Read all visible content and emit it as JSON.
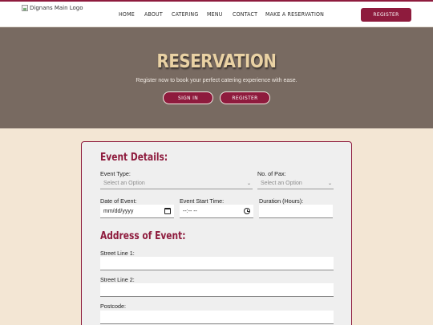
{
  "header": {
    "logo_alt": "Dignans Main Logo",
    "nav": [
      {
        "label": "HOME"
      },
      {
        "label": "ABOUT"
      },
      {
        "label": "CATERING"
      },
      {
        "label": "MENU"
      },
      {
        "label": "CONTACT"
      },
      {
        "label": "MAKE A RESERVATION"
      }
    ],
    "register_label": "REGISTER"
  },
  "hero": {
    "title": "RESERVATION",
    "subtitle": "Register now to book your perfect catering experience with ease.",
    "sign_in_label": "SIGN IN",
    "register_label": "REGISTER"
  },
  "form": {
    "event_details": {
      "title": "Event Details:",
      "event_type": {
        "label": "Event Type:",
        "value": "Select an Option"
      },
      "pax": {
        "label": "No. of Pax:",
        "value": "Select an Option"
      },
      "date": {
        "label": "Date of Event:",
        "value": "mm/dd/yyyy"
      },
      "start_time": {
        "label": "Event Start Time:",
        "value": "--:-- --"
      },
      "duration": {
        "label": "Duration (Hours):",
        "value": ""
      }
    },
    "address": {
      "title": "Address of Event:",
      "street1": {
        "label": "Street Line 1:",
        "value": ""
      },
      "street2": {
        "label": "Street Line 2:",
        "value": ""
      },
      "postcode": {
        "label": "Postcode:",
        "value": ""
      }
    }
  },
  "colors": {
    "brand": "#8e1b3d",
    "hero_bg": "#786a61",
    "page_bg": "#f3e6d4",
    "hero_title": "#ead2a4"
  }
}
